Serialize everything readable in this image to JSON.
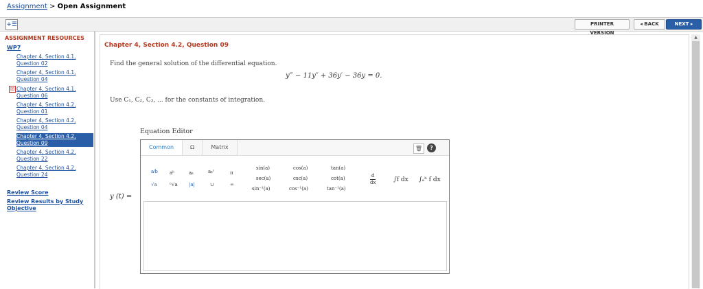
{
  "breadcrumb": {
    "link": "Assignment",
    "separator": ">",
    "current": "Open Assignment"
  },
  "toolbar": {
    "menu_icon": "+☰",
    "printer": "PRINTER VERSION",
    "back": "◂ BACK",
    "next": "NEXT ▸"
  },
  "sidebar": {
    "title": "ASSIGNMENT RESOURCES",
    "group": "WP7",
    "questions": [
      {
        "line1": "Chapter 4, Section 4.1,",
        "line2": "Question 02"
      },
      {
        "line1": "Chapter 4, Section 4.1,",
        "line2": "Question 04"
      },
      {
        "line1": "Chapter 4, Section 4.1,",
        "line2": "Question 06"
      },
      {
        "line1": "Chapter 4, Section 4.2,",
        "line2": "Question 01"
      },
      {
        "line1": "Chapter 4, Section 4.2,",
        "line2": "Question 04"
      },
      {
        "line1": "Chapter 4, Section 4.2,",
        "line2": "Question 09"
      },
      {
        "line1": "Chapter 4, Section 4.2,",
        "line2": "Question 22"
      },
      {
        "line1": "Chapter 4, Section 4.2,",
        "line2": "Question 24"
      }
    ],
    "mark": "☒",
    "review_score": "Review Score",
    "review_results_1": "Review Results by Study",
    "review_results_2": "Objective"
  },
  "question": {
    "title": "Chapter 4, Section 4.2, Question 09",
    "prompt": "Find the general solution of the differential equation.",
    "equation": "y‴ − 11y″ + 36y′ − 36y = 0.",
    "constants_note": "Use C₁, C₂, C₃, ... for the constants of integration.",
    "editor_label": "Equation Editor",
    "y_label": "y (t) ="
  },
  "editor": {
    "tabs": {
      "common": "Common",
      "omega": "Ω",
      "matrix": "Matrix"
    },
    "trash": "🗑",
    "help": "?",
    "symbols": {
      "frac": "a⁄b",
      "power": "aᵇ",
      "sub": "aᵦ",
      "subsup": "aᵦᶜ",
      "pi": "π",
      "sqrt": "√a",
      "nroot": "ⁿ√a",
      "abs": "|a|",
      "union": "∪",
      "infinity": "∞",
      "sin": "sin(a)",
      "sec": "sec(a)",
      "asin": "sin⁻¹(a)",
      "cos": "cos(a)",
      "csc": "csc(a)",
      "acos": "cos⁻¹(a)",
      "tan": "tan(a)",
      "cot": "cot(a)",
      "atan": "tan⁻¹(a)",
      "deriv_num": "d",
      "deriv_den": "dx",
      "integral": "∫f dx",
      "def_integral": "∫ₐᵇ f dx"
    }
  }
}
